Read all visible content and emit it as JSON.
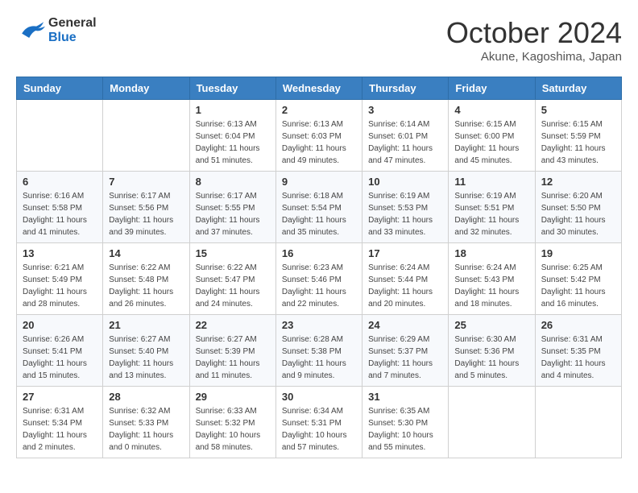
{
  "logo": {
    "line1": "General",
    "line2": "Blue"
  },
  "title": "October 2024",
  "location": "Akune, Kagoshima, Japan",
  "days_of_week": [
    "Sunday",
    "Monday",
    "Tuesday",
    "Wednesday",
    "Thursday",
    "Friday",
    "Saturday"
  ],
  "weeks": [
    [
      {
        "day": null,
        "info": null
      },
      {
        "day": null,
        "info": null
      },
      {
        "day": "1",
        "info": "Sunrise: 6:13 AM\nSunset: 6:04 PM\nDaylight: 11 hours and 51 minutes."
      },
      {
        "day": "2",
        "info": "Sunrise: 6:13 AM\nSunset: 6:03 PM\nDaylight: 11 hours and 49 minutes."
      },
      {
        "day": "3",
        "info": "Sunrise: 6:14 AM\nSunset: 6:01 PM\nDaylight: 11 hours and 47 minutes."
      },
      {
        "day": "4",
        "info": "Sunrise: 6:15 AM\nSunset: 6:00 PM\nDaylight: 11 hours and 45 minutes."
      },
      {
        "day": "5",
        "info": "Sunrise: 6:15 AM\nSunset: 5:59 PM\nDaylight: 11 hours and 43 minutes."
      }
    ],
    [
      {
        "day": "6",
        "info": "Sunrise: 6:16 AM\nSunset: 5:58 PM\nDaylight: 11 hours and 41 minutes."
      },
      {
        "day": "7",
        "info": "Sunrise: 6:17 AM\nSunset: 5:56 PM\nDaylight: 11 hours and 39 minutes."
      },
      {
        "day": "8",
        "info": "Sunrise: 6:17 AM\nSunset: 5:55 PM\nDaylight: 11 hours and 37 minutes."
      },
      {
        "day": "9",
        "info": "Sunrise: 6:18 AM\nSunset: 5:54 PM\nDaylight: 11 hours and 35 minutes."
      },
      {
        "day": "10",
        "info": "Sunrise: 6:19 AM\nSunset: 5:53 PM\nDaylight: 11 hours and 33 minutes."
      },
      {
        "day": "11",
        "info": "Sunrise: 6:19 AM\nSunset: 5:51 PM\nDaylight: 11 hours and 32 minutes."
      },
      {
        "day": "12",
        "info": "Sunrise: 6:20 AM\nSunset: 5:50 PM\nDaylight: 11 hours and 30 minutes."
      }
    ],
    [
      {
        "day": "13",
        "info": "Sunrise: 6:21 AM\nSunset: 5:49 PM\nDaylight: 11 hours and 28 minutes."
      },
      {
        "day": "14",
        "info": "Sunrise: 6:22 AM\nSunset: 5:48 PM\nDaylight: 11 hours and 26 minutes."
      },
      {
        "day": "15",
        "info": "Sunrise: 6:22 AM\nSunset: 5:47 PM\nDaylight: 11 hours and 24 minutes."
      },
      {
        "day": "16",
        "info": "Sunrise: 6:23 AM\nSunset: 5:46 PM\nDaylight: 11 hours and 22 minutes."
      },
      {
        "day": "17",
        "info": "Sunrise: 6:24 AM\nSunset: 5:44 PM\nDaylight: 11 hours and 20 minutes."
      },
      {
        "day": "18",
        "info": "Sunrise: 6:24 AM\nSunset: 5:43 PM\nDaylight: 11 hours and 18 minutes."
      },
      {
        "day": "19",
        "info": "Sunrise: 6:25 AM\nSunset: 5:42 PM\nDaylight: 11 hours and 16 minutes."
      }
    ],
    [
      {
        "day": "20",
        "info": "Sunrise: 6:26 AM\nSunset: 5:41 PM\nDaylight: 11 hours and 15 minutes."
      },
      {
        "day": "21",
        "info": "Sunrise: 6:27 AM\nSunset: 5:40 PM\nDaylight: 11 hours and 13 minutes."
      },
      {
        "day": "22",
        "info": "Sunrise: 6:27 AM\nSunset: 5:39 PM\nDaylight: 11 hours and 11 minutes."
      },
      {
        "day": "23",
        "info": "Sunrise: 6:28 AM\nSunset: 5:38 PM\nDaylight: 11 hours and 9 minutes."
      },
      {
        "day": "24",
        "info": "Sunrise: 6:29 AM\nSunset: 5:37 PM\nDaylight: 11 hours and 7 minutes."
      },
      {
        "day": "25",
        "info": "Sunrise: 6:30 AM\nSunset: 5:36 PM\nDaylight: 11 hours and 5 minutes."
      },
      {
        "day": "26",
        "info": "Sunrise: 6:31 AM\nSunset: 5:35 PM\nDaylight: 11 hours and 4 minutes."
      }
    ],
    [
      {
        "day": "27",
        "info": "Sunrise: 6:31 AM\nSunset: 5:34 PM\nDaylight: 11 hours and 2 minutes."
      },
      {
        "day": "28",
        "info": "Sunrise: 6:32 AM\nSunset: 5:33 PM\nDaylight: 11 hours and 0 minutes."
      },
      {
        "day": "29",
        "info": "Sunrise: 6:33 AM\nSunset: 5:32 PM\nDaylight: 10 hours and 58 minutes."
      },
      {
        "day": "30",
        "info": "Sunrise: 6:34 AM\nSunset: 5:31 PM\nDaylight: 10 hours and 57 minutes."
      },
      {
        "day": "31",
        "info": "Sunrise: 6:35 AM\nSunset: 5:30 PM\nDaylight: 10 hours and 55 minutes."
      },
      {
        "day": null,
        "info": null
      },
      {
        "day": null,
        "info": null
      }
    ]
  ]
}
